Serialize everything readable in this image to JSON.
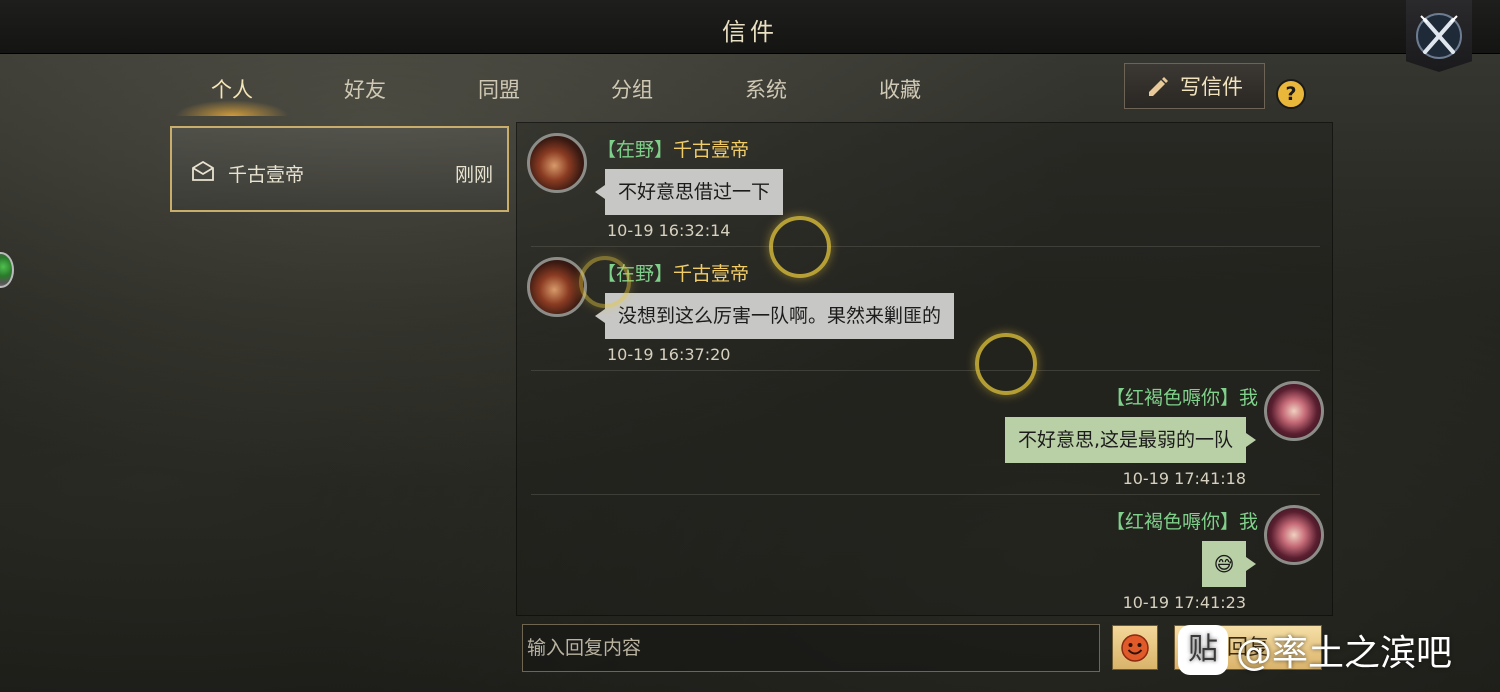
{
  "window": {
    "title": "信件"
  },
  "tabs": [
    {
      "label": "个人",
      "active": true
    },
    {
      "label": "好友",
      "active": false
    },
    {
      "label": "同盟",
      "active": false
    },
    {
      "label": "分组",
      "active": false
    },
    {
      "label": "系统",
      "active": false
    },
    {
      "label": "收藏",
      "active": false
    }
  ],
  "toolbar": {
    "write_label": "写信件",
    "help_label": "?"
  },
  "mail_list": [
    {
      "name": "千古壹帝",
      "time": "刚刚",
      "icon": "envelope-icon"
    }
  ],
  "messages": [
    {
      "side": "left",
      "alliance": "【在野】",
      "name": "千古壹帝",
      "text": "不好意思借过一下",
      "time": "10-19 16:32:14"
    },
    {
      "side": "left",
      "alliance": "【在野】",
      "name": "千古壹帝",
      "text": "没想到这么厉害一队啊。果然来剿匪的",
      "time": "10-19 16:37:20"
    },
    {
      "side": "right",
      "alliance": "【红褐色嗕你】",
      "name": "我",
      "text": "不好意思,这是最弱的一队",
      "time": "10-19 17:41:18"
    },
    {
      "side": "right",
      "alliance": "【红褐色嗕你】",
      "name": "我",
      "text": "😅",
      "time": "10-19 17:41:23"
    }
  ],
  "input": {
    "placeholder": "输入回复内容",
    "send_label": "回复"
  },
  "watermark": {
    "logo": "贴",
    "text": "@率土之滨吧"
  },
  "colors": {
    "accent_gold": "#c8ae6a",
    "alliance_green": "#7fd08a",
    "name_gold": "#f2cc66",
    "bubble_other": "#c7c7c5",
    "bubble_self": "#b9cfa6"
  }
}
